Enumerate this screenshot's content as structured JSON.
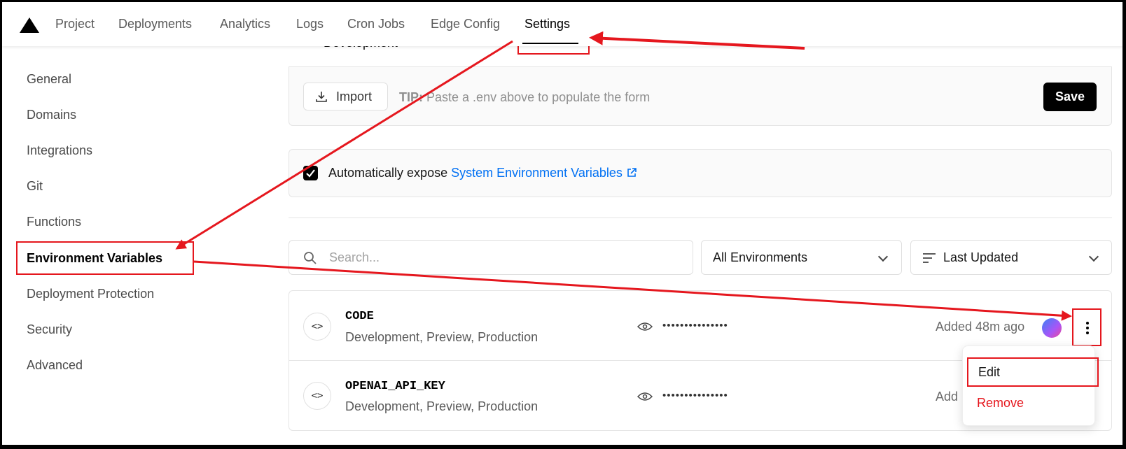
{
  "nav": {
    "tabs": [
      "Project",
      "Deployments",
      "Analytics",
      "Logs",
      "Cron Jobs",
      "Edge Config",
      "Settings"
    ],
    "active_tab": "Settings"
  },
  "top_partial_label": "Development",
  "sidebar": {
    "items": [
      "General",
      "Domains",
      "Integrations",
      "Git",
      "Functions",
      "Environment Variables",
      "Deployment Protection",
      "Security",
      "Advanced"
    ],
    "active_item": "Environment Variables"
  },
  "import_panel": {
    "import_label": "Import",
    "tip_prefix": "TIP:",
    "tip_text": "Paste a .env above to populate the form",
    "save_label": "Save"
  },
  "expose_panel": {
    "checked": true,
    "label": "Automatically expose",
    "link_text": "System Environment Variables"
  },
  "filters": {
    "search_placeholder": "Search...",
    "environment_select": "All Environments",
    "sort_select": "Last Updated"
  },
  "variables": [
    {
      "name": "CODE",
      "environments": "Development, Preview, Production",
      "masked_value": "•••••••••••••••",
      "added": "Added 48m ago"
    },
    {
      "name": "OPENAI_API_KEY",
      "environments": "Development, Preview, Production",
      "masked_value": "•••••••••••••••",
      "added": "Add"
    }
  ],
  "context_menu": {
    "edit_label": "Edit",
    "remove_label": "Remove"
  },
  "colors": {
    "accent_link": "#0070f3",
    "annotation_red": "#e5171e",
    "remove_red": "#e5171e"
  }
}
